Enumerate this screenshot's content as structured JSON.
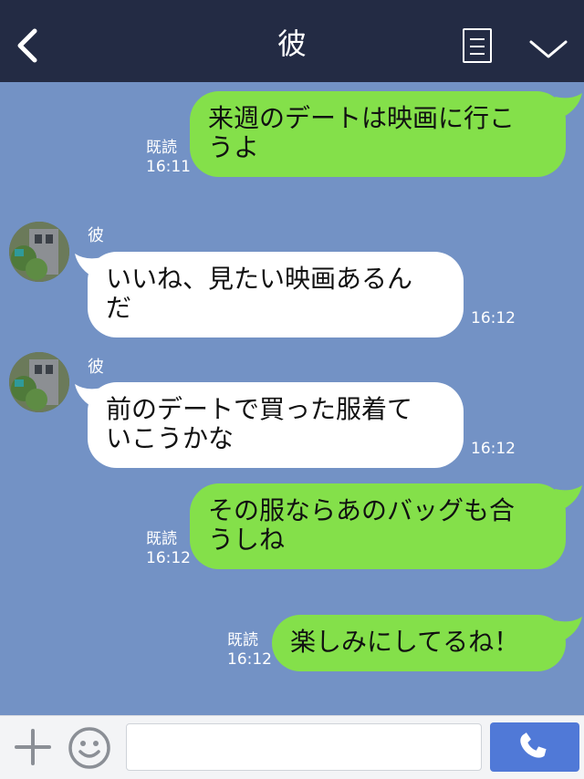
{
  "header": {
    "title": "彼"
  },
  "messages": [
    {
      "side": "out",
      "text": "来週のデートは映画に行こうよ",
      "line1": "来週のデートは映画に行こ",
      "line2": "うよ",
      "read": "既読",
      "time": "16:11"
    },
    {
      "side": "in",
      "sender": "彼",
      "line1": "いいね、見たい映画あるん",
      "line2": "だ",
      "time": "16:12"
    },
    {
      "side": "in",
      "sender": "彼",
      "line1": "前のデートで買った服着て",
      "line2": "いこうかな",
      "time": "16:12"
    },
    {
      "side": "out",
      "line1": "その服ならあのバッグも合",
      "line2": "うしね",
      "read": "既読",
      "time": "16:12"
    },
    {
      "side": "out",
      "line1": "楽しみにしてるね！",
      "read": "既読",
      "time": "16:12"
    }
  ],
  "input_bar": {
    "value": "",
    "icons": [
      "plus-icon",
      "smiley-icon",
      "phone-icon"
    ]
  },
  "colors": {
    "header_bg": "#232b44",
    "chat_bg": "#7392c5",
    "outgoing_bubble": "#84e04a",
    "incoming_bubble": "#ffffff",
    "call_button": "#5079d7"
  }
}
